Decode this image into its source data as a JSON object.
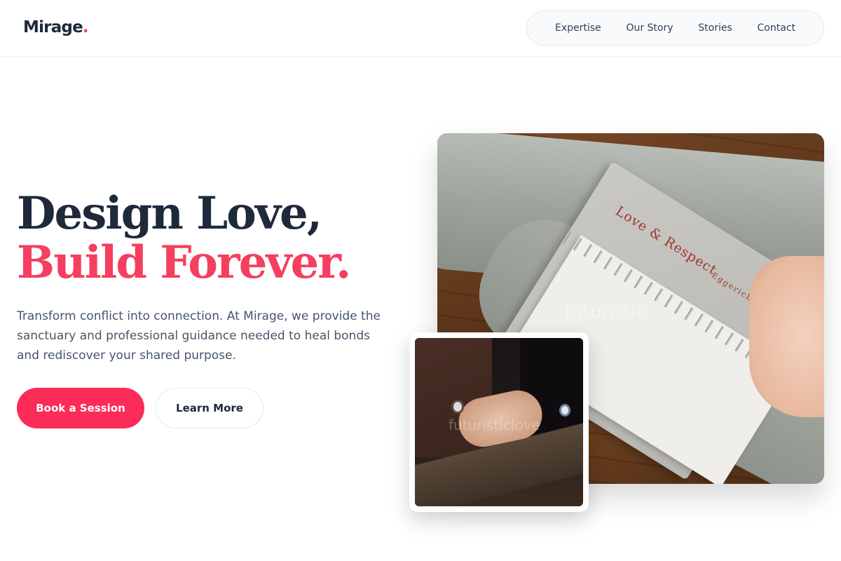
{
  "brand": {
    "name": "Mirage",
    "dot": ".",
    "accent_color": "#f43f5e"
  },
  "nav": {
    "items": [
      {
        "label": "Expertise"
      },
      {
        "label": "Our Story"
      },
      {
        "label": "Stories"
      },
      {
        "label": "Contact"
      }
    ]
  },
  "hero": {
    "headline_line1": "Design Love,",
    "headline_line2": "Build Forever.",
    "lead": "Transform conflict into connection. At Mirage, we provide the sanctuary and professional guidance needed to heal bonds and rediscover your shared purpose.",
    "primary_cta": "Book a Session",
    "secondary_cta": "Learn More"
  },
  "images": {
    "main": {
      "book_title": "Love & Respect",
      "book_author": "Eggerichs",
      "watermark": "futuristic"
    },
    "secondary": {
      "watermark": "futuristiclove"
    }
  }
}
